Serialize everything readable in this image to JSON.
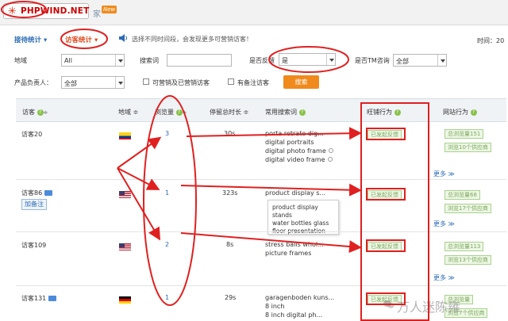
{
  "brand": {
    "text": "PHPWIND.NET",
    "star": "✳"
  },
  "top_tabs": {
    "visitor_tab": "家",
    "new_badge": "New"
  },
  "subtabs": {
    "tab1": "接待统计 ▾",
    "tab2": "访客统计 ▾"
  },
  "notice": "选择不同时间段，会发现更多可营销访客！",
  "time_label": "时间：20",
  "filters": {
    "region_label": "地域",
    "region_value": "All",
    "keyword_label": "搜索词",
    "feedback_label": "是否反馈",
    "feedback_value": "是",
    "tm_label": "是否TM咨询",
    "tm_value": "全部",
    "owner_label": "产品负责人：",
    "owner_value": "全部",
    "check_marketable": "可营销及已营销访客",
    "check_note": "有备注访客",
    "search_button": "搜索"
  },
  "table": {
    "headers": {
      "visitor": "访客",
      "region": "地域 ≑",
      "views": "浏览量",
      "stay": "停留总时长 ≑",
      "keywords": "常用搜索词",
      "wangwang": "旺铺行为",
      "site": "网站行为"
    },
    "rows": [
      {
        "visitor": "访客20",
        "views": "3",
        "stay": "30s",
        "keywords": [
          "porta retrato dig...",
          "digital portraits",
          "digital photo frame",
          "digital video frame"
        ],
        "ww_tag": "已发起反馈",
        "site_tags": [
          "总浏览量151",
          "浏览10个供应商"
        ]
      },
      {
        "visitor": "访客86",
        "note_button": "加备注",
        "views": "1",
        "stay": "323s",
        "keywords": [
          "product display s..."
        ],
        "ww_tag": "已发起反馈",
        "site_tags": [
          "总浏览量68",
          "浏览17个供应商"
        ]
      },
      {
        "visitor": "访客109",
        "views": "2",
        "stay": "8s",
        "keywords": [
          "stress balls whol...",
          "picture frames"
        ],
        "ww_tag": "已发起反馈",
        "site_tags": [
          "总浏览量113",
          "浏览13个供应商"
        ]
      },
      {
        "visitor": "访客131",
        "views": "1",
        "stay": "29s",
        "keywords": [
          "garagenboden kuns...",
          "8 inch",
          "8 inch digital ph..."
        ],
        "ww_tag": "已发起反馈",
        "site_tags": [
          "总浏览量",
          "浏览7个供应商"
        ]
      }
    ],
    "tooltip": [
      "product display stands",
      "water bottles glass",
      "floor presentation"
    ],
    "more_label": "更多 ≫"
  },
  "watermark": "万人迷陈雍",
  "colors": {
    "annotation_red": "#e02020",
    "link_blue": "#2c6bb5",
    "accent_orange": "#f08a1c",
    "tag_green": "#7aa85a"
  }
}
